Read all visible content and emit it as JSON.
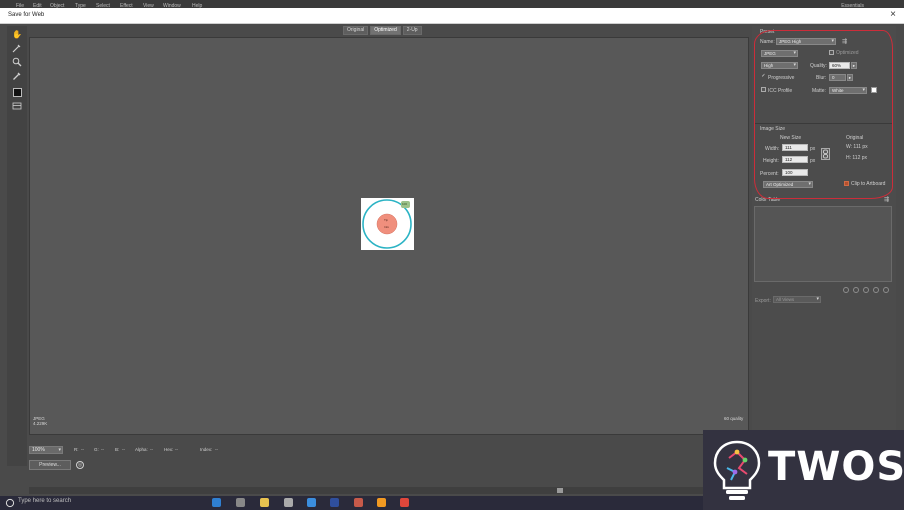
{
  "menubar": {
    "items": [
      "File",
      "Edit",
      "Object",
      "Type",
      "Select",
      "Effect",
      "View",
      "Window",
      "Help"
    ],
    "workspace": "Essentials"
  },
  "titlebar": {
    "title": "Save for Web",
    "close_glyph": "×"
  },
  "view_tabs": [
    "Original",
    "Optimized",
    "2-Up"
  ],
  "view_tabs_active": "Optimized",
  "artwork": {
    "outer_label": "100",
    "inner_label_top": "Tip",
    "inner_label_bottom": "Info"
  },
  "canvas_info": {
    "format": "JPEG",
    "size": "4.229K",
    "quality": "60 quality"
  },
  "status": {
    "zoom": "100%",
    "r_label": "R:",
    "r_value": "--",
    "g_label": "G:",
    "g_value": "--",
    "b_label": "B:",
    "b_value": "--",
    "alpha_label": "Alpha:",
    "alpha_value": "--",
    "hex_label": "Hex:",
    "hex_value": "--",
    "index_label": "Index:",
    "index_value": "--",
    "preview_label": "Preview..."
  },
  "preset": {
    "section_label": "Preset",
    "name_label": "Name:",
    "name_value": "JPEG High",
    "format": "JPEG",
    "optimized_label": "Optimized",
    "compression": "High",
    "quality_label": "Quality:",
    "quality_value": "60%",
    "progressive_label": "Progressive",
    "blur_label": "Blur:",
    "blur_value": "0",
    "icc_label": "ICC Profile",
    "matte_label": "Matte:",
    "matte_value": "White"
  },
  "image_size": {
    "section_label": "Image Size",
    "new_size_label": "New Size",
    "original_label": "Original",
    "width_label": "Width:",
    "width_value": "111",
    "height_label": "Height:",
    "height_value": "112",
    "px": "px",
    "percent_label": "Percent:",
    "percent_value": "100",
    "orig_w": "W:  111 px",
    "orig_h": "H:  112 px",
    "art_option": "Art Optimized",
    "clip_label": "Clip to Artboard"
  },
  "color_table": {
    "label": "Color Table"
  },
  "export": {
    "label": "Export:",
    "value": "All Views"
  },
  "taskbar": {
    "search_placeholder": "Type here to search"
  },
  "watermark": {
    "text": "TWOS"
  },
  "colors": {
    "annotation": "#cc2d3a",
    "circle_ring": "#2bb3c4",
    "circle_fill": "#f08f7d"
  }
}
